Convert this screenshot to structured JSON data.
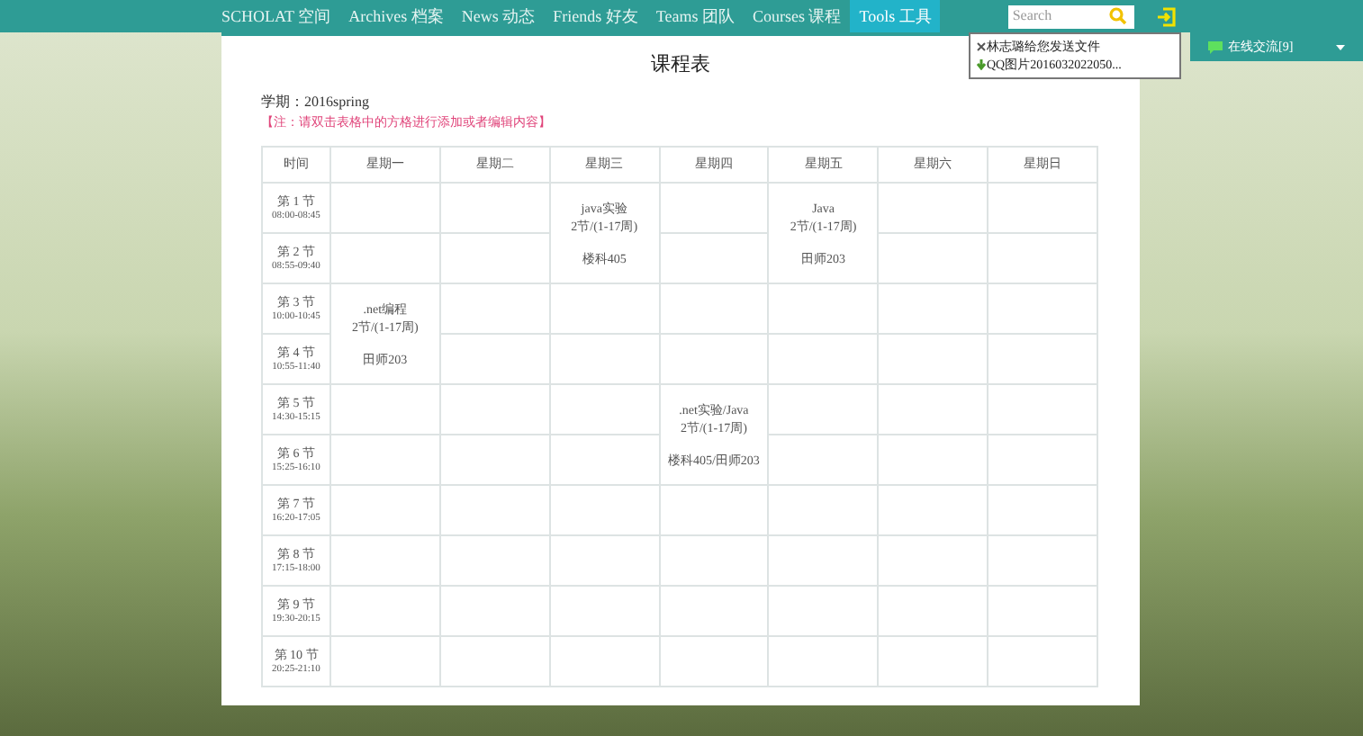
{
  "nav": {
    "items": [
      {
        "label": "SCHOLAT 空间",
        "selected": false
      },
      {
        "label": "Archives 档案",
        "selected": false
      },
      {
        "label": "News 动态",
        "selected": false
      },
      {
        "label": "Friends 好友",
        "selected": false
      },
      {
        "label": "Teams 团队",
        "selected": false
      },
      {
        "label": "Courses 课程",
        "selected": false
      },
      {
        "label": "Tools 工具",
        "selected": true
      }
    ],
    "search": {
      "placeholder": "Search"
    }
  },
  "notifications": [
    "林志璐给您发送文件",
    "QQ图片2016032022050..."
  ],
  "chat": {
    "label": "在线交流[9]"
  },
  "page": {
    "title": "课程表",
    "term": "学期：2016spring",
    "note": "【注：请双击表格中的方格进行添加或者编辑内容】"
  },
  "table": {
    "columns": [
      "时间",
      "星期一",
      "星期二",
      "星期三",
      "星期四",
      "星期五",
      "星期六",
      "星期日"
    ],
    "rows": [
      {
        "cells": [
          {
            "kind": "period",
            "label": "第 1 节",
            "time": "08:00-08:45"
          },
          {
            "kind": "empty"
          },
          {
            "kind": "empty"
          },
          {
            "kind": "course",
            "rowspan": 2,
            "name": "java实验",
            "weeks": "2节/(1-17周)",
            "room": "楼科405"
          },
          {
            "kind": "empty"
          },
          {
            "kind": "course",
            "rowspan": 2,
            "name": "Java",
            "weeks": "2节/(1-17周)",
            "room": "田师203"
          },
          {
            "kind": "empty"
          },
          {
            "kind": "empty"
          }
        ]
      },
      {
        "cells": [
          {
            "kind": "period",
            "label": "第 2 节",
            "time": "08:55-09:40"
          },
          {
            "kind": "empty"
          },
          {
            "kind": "empty"
          },
          {
            "kind": "empty"
          },
          {
            "kind": "empty"
          },
          {
            "kind": "empty"
          }
        ]
      },
      {
        "cells": [
          {
            "kind": "period",
            "label": "第 3 节",
            "time": "10:00-10:45"
          },
          {
            "kind": "course",
            "rowspan": 2,
            "name": ".net编程",
            "weeks": "2节/(1-17周)",
            "room": "田师203"
          },
          {
            "kind": "empty"
          },
          {
            "kind": "empty"
          },
          {
            "kind": "empty"
          },
          {
            "kind": "empty"
          },
          {
            "kind": "empty"
          },
          {
            "kind": "empty"
          }
        ]
      },
      {
        "cells": [
          {
            "kind": "period",
            "label": "第 4 节",
            "time": "10:55-11:40"
          },
          {
            "kind": "empty"
          },
          {
            "kind": "empty"
          },
          {
            "kind": "empty"
          },
          {
            "kind": "empty"
          },
          {
            "kind": "empty"
          },
          {
            "kind": "empty"
          }
        ]
      },
      {
        "cells": [
          {
            "kind": "period",
            "label": "第 5 节",
            "time": "14:30-15:15"
          },
          {
            "kind": "empty"
          },
          {
            "kind": "empty"
          },
          {
            "kind": "empty"
          },
          {
            "kind": "course",
            "rowspan": 2,
            "name": ".net实验/Java",
            "weeks": "2节/(1-17周)",
            "room": "楼科405/田师203"
          },
          {
            "kind": "empty"
          },
          {
            "kind": "empty"
          },
          {
            "kind": "empty"
          }
        ]
      },
      {
        "cells": [
          {
            "kind": "period",
            "label": "第 6 节",
            "time": "15:25-16:10"
          },
          {
            "kind": "empty"
          },
          {
            "kind": "empty"
          },
          {
            "kind": "empty"
          },
          {
            "kind": "empty"
          },
          {
            "kind": "empty"
          },
          {
            "kind": "empty"
          }
        ]
      },
      {
        "cells": [
          {
            "kind": "period",
            "label": "第 7 节",
            "time": "16:20-17:05"
          },
          {
            "kind": "empty"
          },
          {
            "kind": "empty"
          },
          {
            "kind": "empty"
          },
          {
            "kind": "empty"
          },
          {
            "kind": "empty"
          },
          {
            "kind": "empty"
          },
          {
            "kind": "empty"
          }
        ]
      },
      {
        "cells": [
          {
            "kind": "period",
            "label": "第 8 节",
            "time": "17:15-18:00"
          },
          {
            "kind": "empty"
          },
          {
            "kind": "empty"
          },
          {
            "kind": "empty"
          },
          {
            "kind": "empty"
          },
          {
            "kind": "empty"
          },
          {
            "kind": "empty"
          },
          {
            "kind": "empty"
          }
        ]
      },
      {
        "cells": [
          {
            "kind": "period",
            "label": "第 9 节",
            "time": "19:30-20:15"
          },
          {
            "kind": "empty"
          },
          {
            "kind": "empty"
          },
          {
            "kind": "empty"
          },
          {
            "kind": "empty"
          },
          {
            "kind": "empty"
          },
          {
            "kind": "empty"
          },
          {
            "kind": "empty"
          }
        ]
      },
      {
        "cells": [
          {
            "kind": "period",
            "label": "第 10 节",
            "time": "20:25-21:10"
          },
          {
            "kind": "empty"
          },
          {
            "kind": "empty"
          },
          {
            "kind": "empty"
          },
          {
            "kind": "empty"
          },
          {
            "kind": "empty"
          },
          {
            "kind": "empty"
          },
          {
            "kind": "empty"
          }
        ]
      }
    ]
  }
}
